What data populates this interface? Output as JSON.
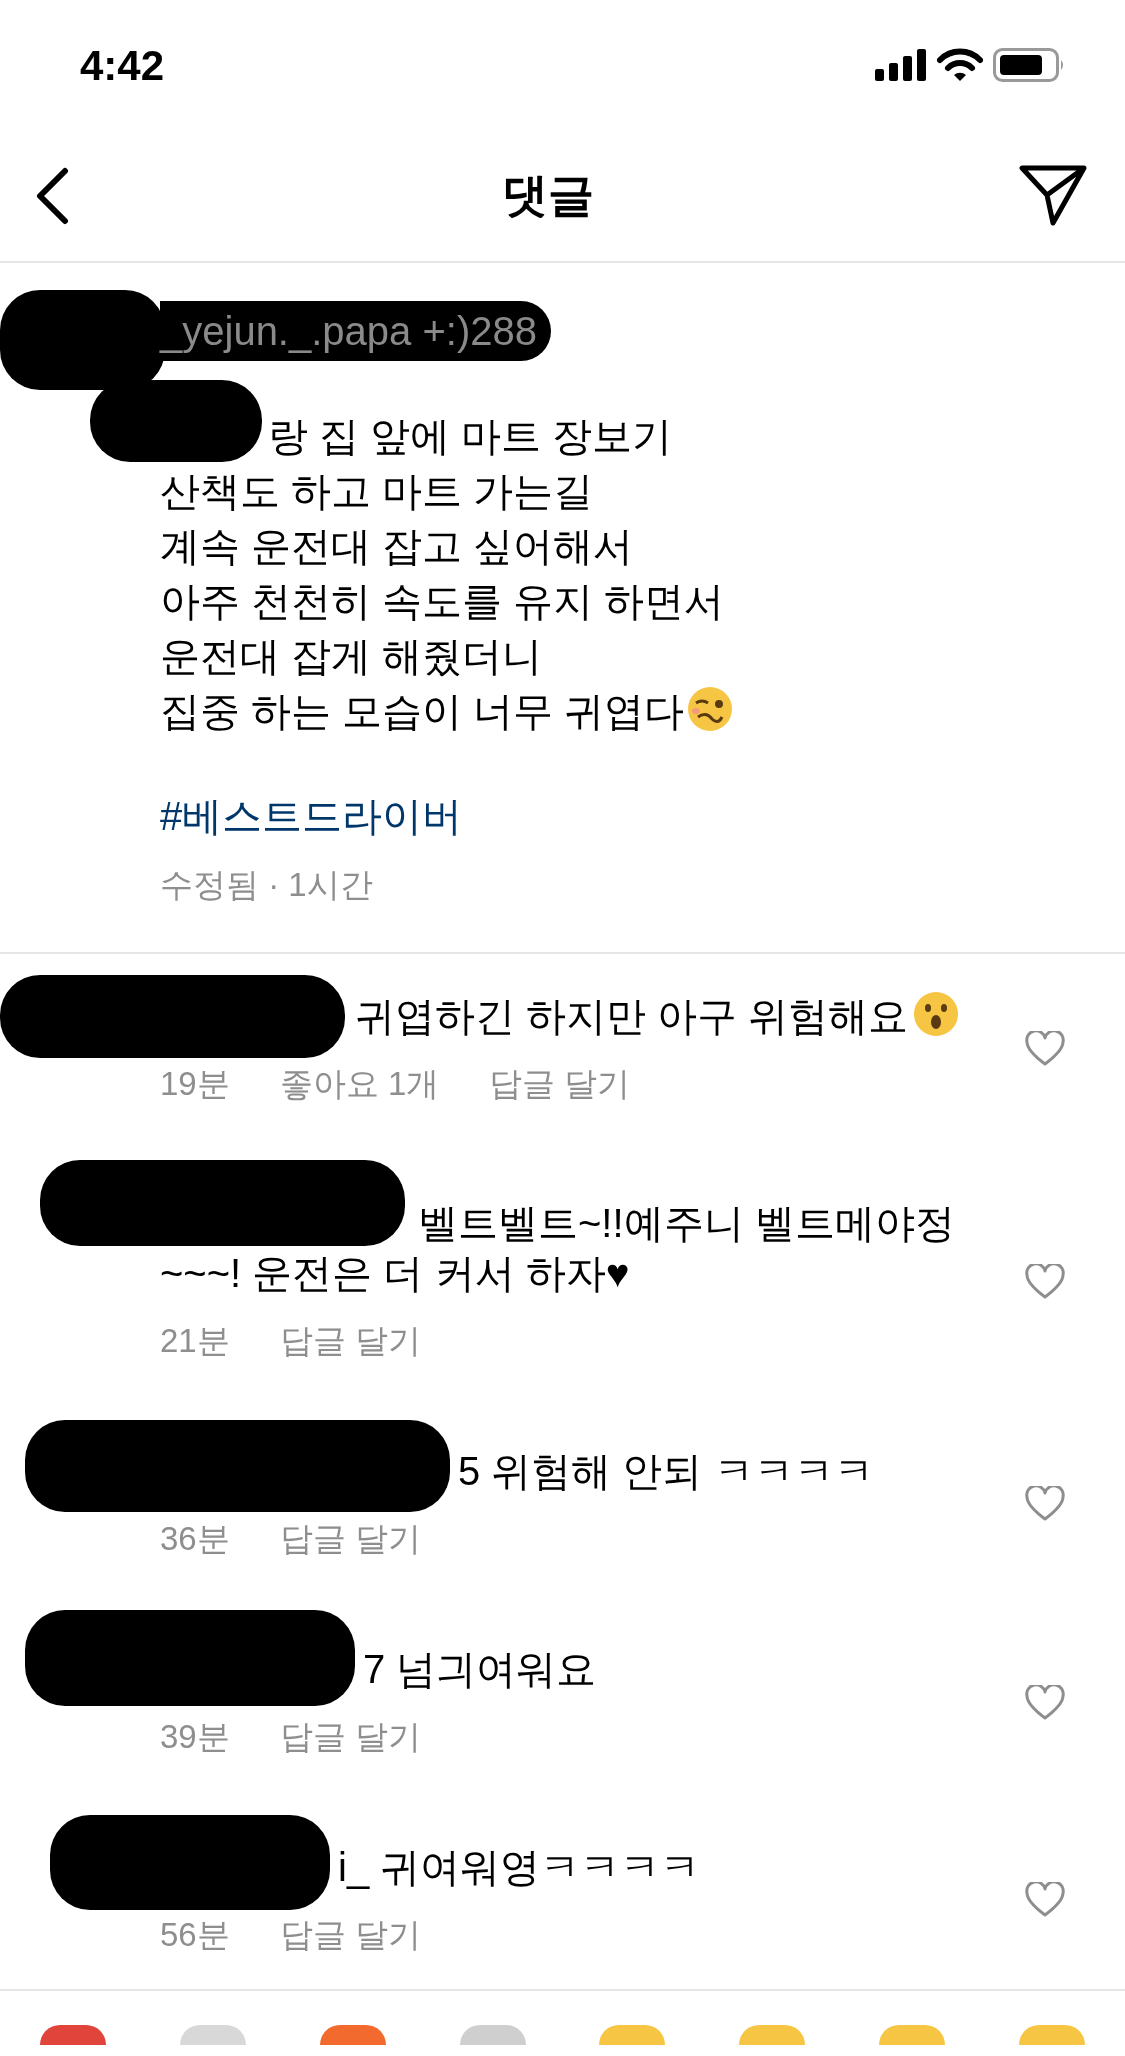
{
  "status_bar": {
    "time": "4:42"
  },
  "header": {
    "title": "댓글"
  },
  "caption": {
    "username": "_yejun._.papa +:)288",
    "lines": [
      "랑 집 앞에 마트 장보기",
      "산책도 하고 마트 가는길",
      "계속 운전대 잡고 싶어해서",
      "아주 천천히 속도를 유지 하면서",
      "운전대 잡게 해줬더니",
      "집중 하는 모습이 너무 귀엽다"
    ],
    "emoji": {
      "kind": "woozy"
    },
    "hashtag": "#베스트드라이버",
    "meta": "수정됨 · 1시간"
  },
  "comments": [
    {
      "lines": [
        "귀엽하긴 하지만 아구 위험해요"
      ],
      "emoji": {
        "kind": "surprised"
      },
      "time": "19분",
      "likes": "좋아요 1개",
      "reply": "답글 달기"
    },
    {
      "lines": [
        "벨트벨트~!!예주니 벨트메야정",
        "~~~! 운전은 더 커서 하자♥"
      ],
      "time": "21분",
      "reply": "답글 달기"
    },
    {
      "lines": [
        "5 위험해 안되 ㅋㅋㅋㅋ"
      ],
      "time": "36분",
      "reply": "답글 달기"
    },
    {
      "lines": [
        "7 넘긔여워요"
      ],
      "time": "39분",
      "reply": "답글 달기"
    },
    {
      "lines": [
        "i_ 귀여워영ㅋㅋㅋㅋ"
      ],
      "time": "56분",
      "reply": "답글 달기"
    }
  ]
}
